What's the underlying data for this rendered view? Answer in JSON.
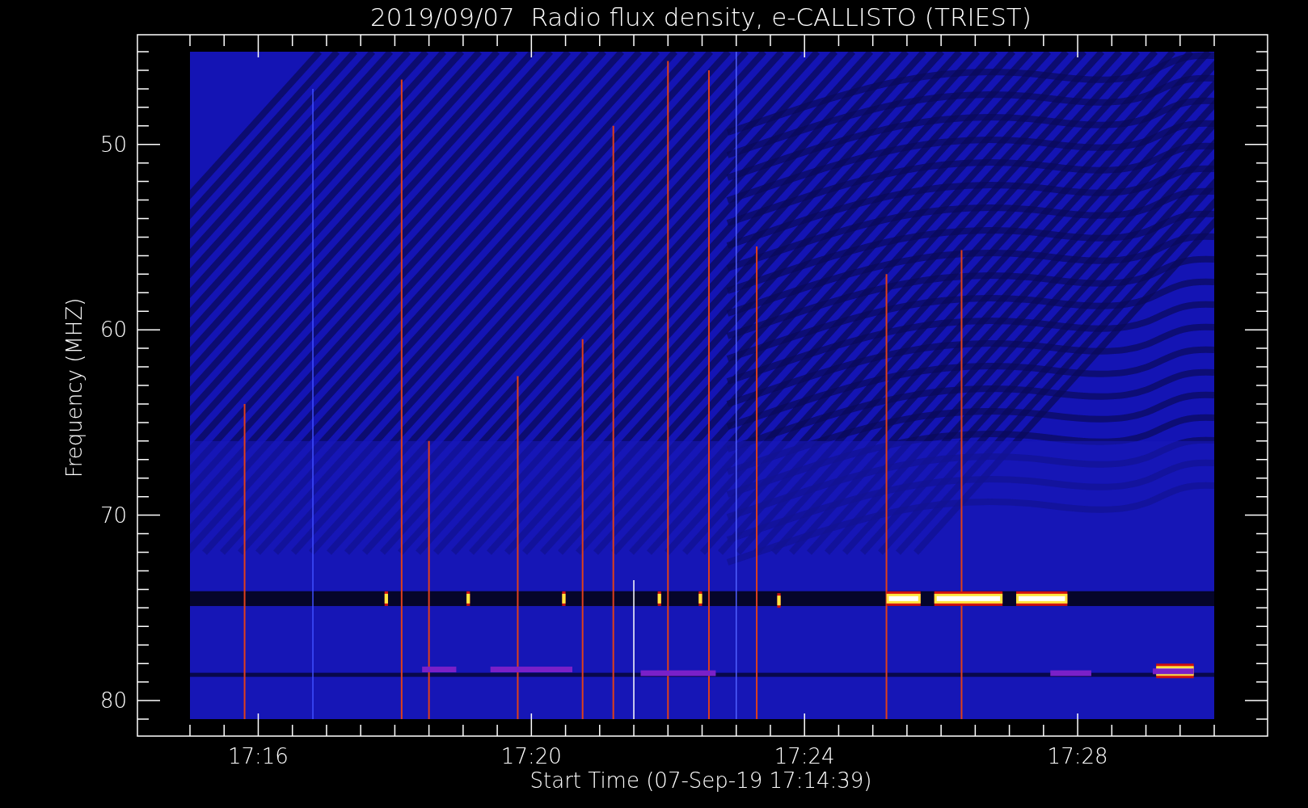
{
  "plot": {
    "title": "2019/09/07  Radio flux density, e-CALLISTO (TRIEST)",
    "xlabel": "Start Time (07-Sep-19 17:14:39)",
    "ylabel": "Frequency (MHZ)",
    "xticks": [
      "17:16",
      "17:20",
      "17:24",
      "17:28"
    ],
    "yticks": [
      "50",
      "60",
      "70",
      "80"
    ]
  }
}
